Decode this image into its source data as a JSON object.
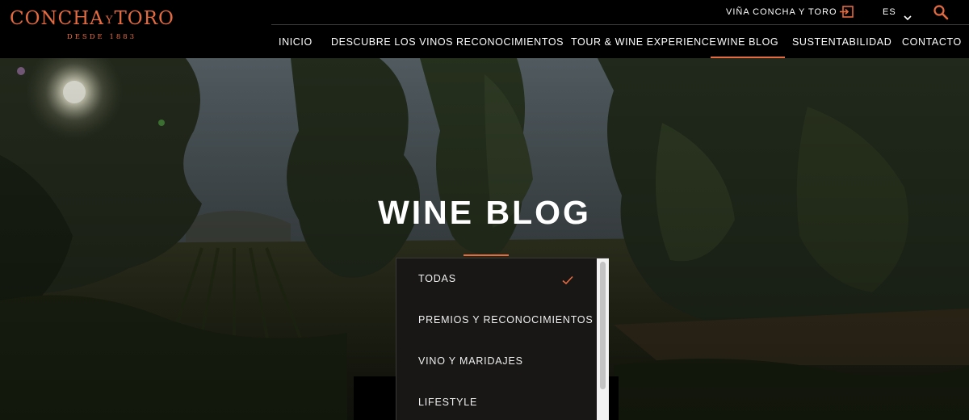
{
  "brand": {
    "logo_left": "CONCHA",
    "logo_amp": "Y",
    "logo_right": "TORO",
    "logo_tagline": "DESDE 1883",
    "accent_color": "#e56a3f"
  },
  "topbar": {
    "brand_link": "VIÑA CONCHA Y TORO",
    "login_icon": "login-icon",
    "language": "ES",
    "language_icon": "chevron-down-icon",
    "search_icon": "search-icon"
  },
  "nav": {
    "items": [
      {
        "label": "INICIO",
        "active": false
      },
      {
        "label": "DESCUBRE LOS VINOS",
        "active": false
      },
      {
        "label": "RECONOCIMIENTOS",
        "active": false
      },
      {
        "label": "TOUR & WINE EXPERIENCE",
        "active": false
      },
      {
        "label": "WINE BLOG",
        "active": true
      },
      {
        "label": "SUSTENTABILIDAD",
        "active": false
      },
      {
        "label": "CONTACTO",
        "active": false
      }
    ]
  },
  "hero": {
    "title": "WINE BLOG"
  },
  "category_dropdown": {
    "selected": "TODAS",
    "options": [
      {
        "label": "TODAS",
        "selected": true
      },
      {
        "label": "PREMIOS Y RECONOCIMIENTOS",
        "selected": false
      },
      {
        "label": "VINO Y MARIDAJES",
        "selected": false
      },
      {
        "label": "LIFESTYLE",
        "selected": false
      }
    ],
    "check_icon": "check-icon"
  }
}
